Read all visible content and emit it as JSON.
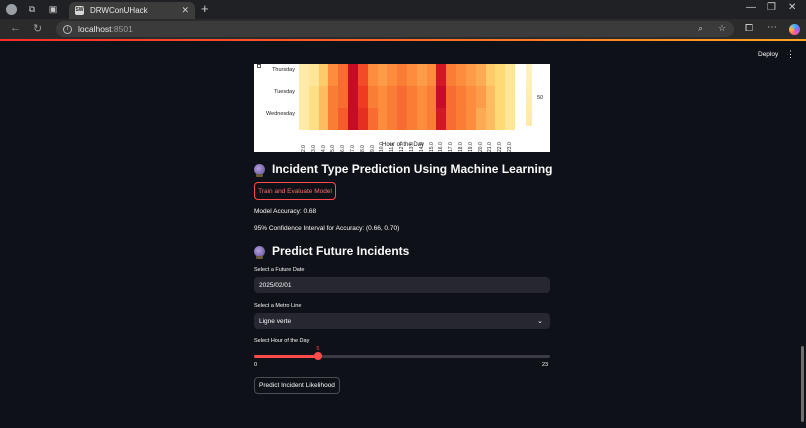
{
  "browser": {
    "tab_title": "DRWConUHack",
    "url_host": "localhost",
    "url_port": ":8501"
  },
  "app": {
    "deploy_label": "Deploy"
  },
  "heatmap": {
    "y_labels": [
      "Thursday",
      "Tuesday",
      "Wednesday"
    ],
    "x_ticks": [
      "2.0",
      "3.0",
      "4.0",
      "5.0",
      "6.0",
      "7.0",
      "8.0",
      "9.0",
      "10.0",
      "11.0",
      "12.0",
      "13.0",
      "14.0",
      "15.0",
      "16.0",
      "17.0",
      "18.0",
      "19.0",
      "20.0",
      "21.0",
      "22.0",
      "23.0"
    ],
    "xlabel": "Hour of the Day",
    "colorbar_label": "50",
    "rows": [
      [
        0.1,
        0.15,
        0.3,
        0.5,
        0.6,
        0.95,
        0.7,
        0.5,
        0.45,
        0.5,
        0.55,
        0.5,
        0.45,
        0.5,
        0.9,
        0.55,
        0.5,
        0.45,
        0.4,
        0.3,
        0.25,
        0.15
      ],
      [
        0.1,
        0.2,
        0.35,
        0.55,
        0.6,
        0.95,
        0.75,
        0.55,
        0.5,
        0.55,
        0.6,
        0.55,
        0.5,
        0.55,
        0.95,
        0.6,
        0.55,
        0.5,
        0.45,
        0.35,
        0.25,
        0.15
      ],
      [
        0.1,
        0.2,
        0.35,
        0.55,
        0.65,
        0.95,
        0.8,
        0.6,
        0.5,
        0.55,
        0.6,
        0.55,
        0.5,
        0.55,
        0.9,
        0.6,
        0.55,
        0.5,
        0.4,
        0.35,
        0.25,
        0.15
      ]
    ]
  },
  "ml_section": {
    "title": "Incident Type Prediction Using Machine Learning",
    "train_button": "Train and Evaluate Model",
    "accuracy_text": "Model Accuracy: 0.68",
    "ci_text": "95% Confidence Interval for Accuracy: (0.66, 0.70)"
  },
  "predict_section": {
    "title": "Predict Future Incidents",
    "date_label": "Select a Future Date",
    "date_value": "2025/02/01",
    "line_label": "Select a Metro Line",
    "line_value": "Ligne verte",
    "hour_label": "Select Hour of the Day",
    "hour_value": "5",
    "hour_min": "0",
    "hour_max": "23",
    "predict_button": "Predict Incident Likelihood"
  }
}
